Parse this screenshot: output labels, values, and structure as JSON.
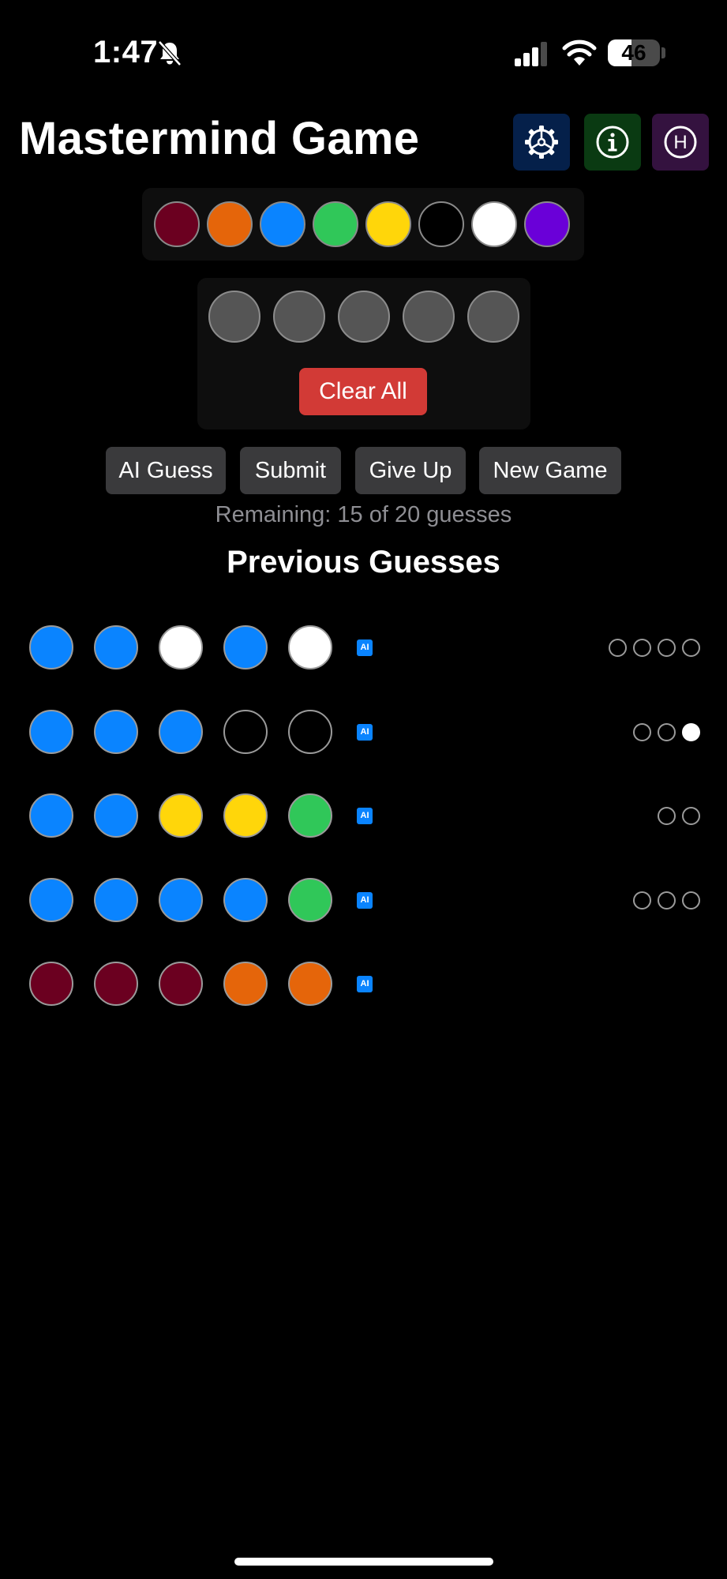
{
  "status_bar": {
    "time": "1:47",
    "battery": "46",
    "battery_level": 0.46,
    "icons": [
      "bell-slash-icon",
      "cellular-signal-icon",
      "wifi-icon",
      "battery-icon"
    ]
  },
  "header": {
    "title": "Mastermind Game",
    "buttons": [
      {
        "icon": "gear-icon",
        "color": "#05204a"
      },
      {
        "icon": "info-icon",
        "color": "#0a3a12"
      },
      {
        "icon": "history-icon",
        "glyph": "H",
        "color": "#34123f"
      }
    ]
  },
  "palette": {
    "colors": [
      "#6b0020",
      "#e5650a",
      "#0a84ff",
      "#30c759",
      "#ffd60a",
      "#000000",
      "#ffffff",
      "#6a00d8"
    ]
  },
  "current_guess": {
    "slot_color": "#555555",
    "slots": 5,
    "clear_label": "Clear All"
  },
  "actions": {
    "ai_guess": "AI Guess",
    "submit": "Submit",
    "give_up": "Give Up",
    "new_game": "New Game"
  },
  "remaining": "Remaining: 15 of 20 guesses",
  "previous_title": "Previous Guesses",
  "guesses": [
    {
      "pegs": [
        "#0a84ff",
        "#0a84ff",
        "#ffffff",
        "#0a84ff",
        "#ffffff"
      ],
      "ai": "AI",
      "feedback": [
        "empty",
        "empty",
        "empty",
        "empty"
      ]
    },
    {
      "pegs": [
        "#0a84ff",
        "#0a84ff",
        "#0a84ff",
        "#000000",
        "#000000"
      ],
      "ai": "AI",
      "feedback": [
        "empty",
        "empty",
        "filled"
      ]
    },
    {
      "pegs": [
        "#0a84ff",
        "#0a84ff",
        "#ffd60a",
        "#ffd60a",
        "#30c759"
      ],
      "ai": "AI",
      "feedback": [
        "empty",
        "empty"
      ]
    },
    {
      "pegs": [
        "#0a84ff",
        "#0a84ff",
        "#0a84ff",
        "#0a84ff",
        "#30c759"
      ],
      "ai": "AI",
      "feedback": [
        "empty",
        "empty",
        "empty"
      ]
    },
    {
      "pegs": [
        "#6b0020",
        "#6b0020",
        "#6b0020",
        "#e5650a",
        "#e5650a"
      ],
      "ai": "AI",
      "feedback": []
    }
  ]
}
